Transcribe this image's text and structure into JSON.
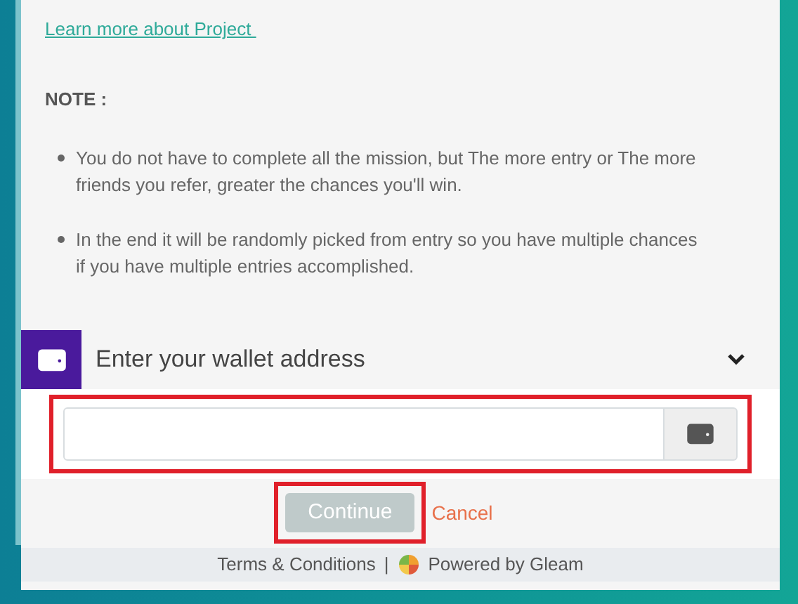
{
  "link": "Learn more about Project ",
  "note_title": "NOTE :",
  "notes": [
    "You do not have to complete all the mission, but The more entry or The more friends you refer, greater the chances you'll win.",
    "In the end it will be randomly picked from entry so you have multiple chances if you have multiple entries accomplished."
  ],
  "entry": {
    "title": "Enter your wallet address",
    "expanded": true
  },
  "continue_button": {
    "label": "Continue",
    "disabled": true
  },
  "cancel": "Cancel",
  "footer": {
    "terms": "Terms & Conditions",
    "separator": "|",
    "powered": "Powered by Gleam"
  }
}
